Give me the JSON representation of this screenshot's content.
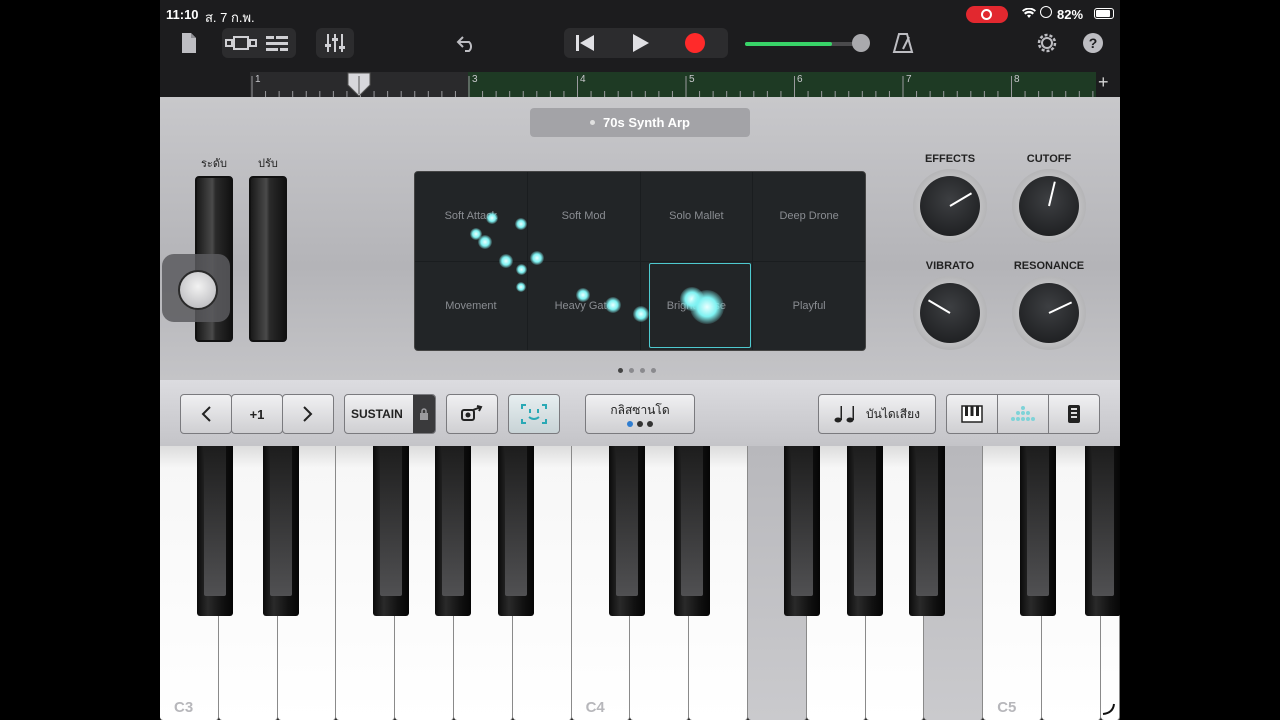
{
  "status": {
    "time": "11:10",
    "date": "ส. 7 ก.พ.",
    "battery": "82%",
    "icons": [
      "recording-indicator",
      "wifi-icon",
      "screen-record-icon",
      "battery-icon"
    ]
  },
  "toolbar": {
    "icons": [
      "document-icon",
      "view-toggle-icon",
      "tracks-icon",
      "mixer-icon",
      "undo-icon",
      "rewind-icon",
      "play-icon",
      "record-icon",
      "metronome-icon",
      "settings-icon",
      "help-icon"
    ],
    "volume": 0.78
  },
  "ruler": {
    "bars": [
      "1",
      "2",
      "3",
      "4",
      "5",
      "6",
      "7",
      "8"
    ],
    "playhead_bar": 2.0
  },
  "synth": {
    "preset": "70s Synth Arp",
    "wheels": {
      "level_label": "ระดับ",
      "tune_label": "ปรับ"
    },
    "pads": [
      "Soft Attack",
      "Soft Mod",
      "Solo Mallet",
      "Deep Drone",
      "Movement",
      "Heavy Gate",
      "Bright Pulse",
      "Playful"
    ],
    "selected_pad": 6,
    "knobs": [
      {
        "label": "EFFECTS",
        "value": 0.72
      },
      {
        "label": "CUTOFF",
        "value": 0.55
      },
      {
        "label": "VIBRATO",
        "value": 0.28
      },
      {
        "label": "RESONANCE",
        "value": 0.74
      }
    ],
    "page_count": 4,
    "page_index": 0
  },
  "controls": {
    "octave_value": "+1",
    "sustain": "SUSTAIN",
    "glissando": "กลิสซานโด",
    "scale": "บันไดเสียง"
  },
  "keyboard": {
    "labels": [
      "C3",
      "C4",
      "C5"
    ],
    "pressed": [
      "C#4",
      "F4",
      "B4"
    ]
  }
}
